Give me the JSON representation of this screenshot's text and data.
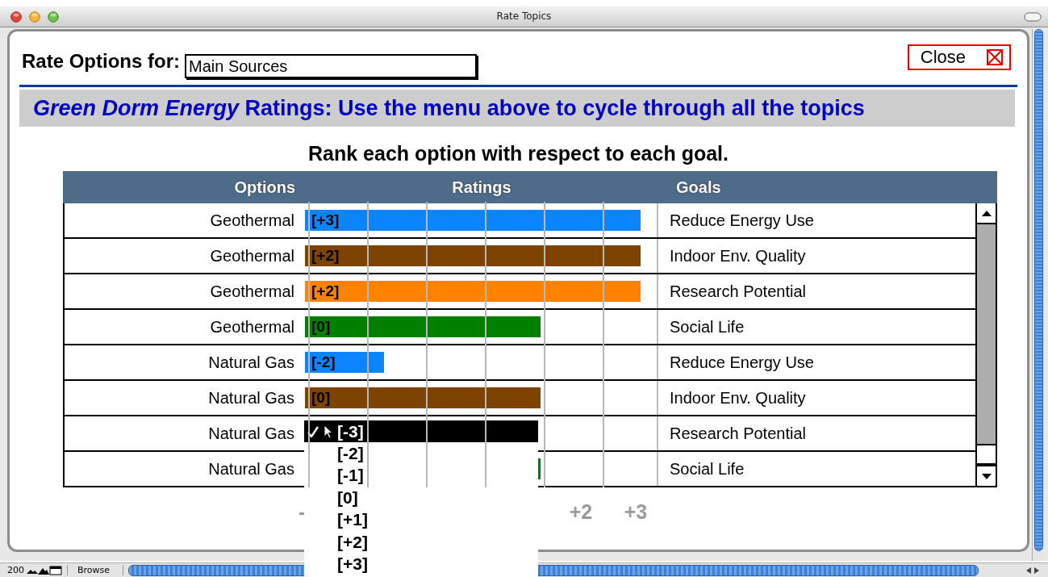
{
  "window": {
    "title": "Rate Topics"
  },
  "header": {
    "label": "Rate Options for:",
    "field_value": "Main Sources",
    "close_button": "Close"
  },
  "banner": "*Green Dorm Energy* Ratings: Use the menu above to cycle through all the topics",
  "instruction": "Rank each option with respect to each goal.",
  "table": {
    "columns": [
      "Options",
      "Ratings",
      "Goals"
    ],
    "rows": [
      {
        "option": "Geothermal",
        "rating": "[+3]",
        "level": 0.955,
        "color": "#0a84ff",
        "goal": "Reduce Energy Use"
      },
      {
        "option": "Geothermal",
        "rating": "[+2]",
        "level": 0.955,
        "color": "#7f4300",
        "goal": "Indoor Env. Quality"
      },
      {
        "option": "Geothermal",
        "rating": "[+2]",
        "level": 0.955,
        "color": "#ff8200",
        "goal": "Research Potential"
      },
      {
        "option": "Geothermal",
        "rating": "[0]",
        "level": 0.67,
        "color": "#007f00",
        "goal": "Social Life"
      },
      {
        "option": "Natural Gas",
        "rating": "[-2]",
        "level": 0.225,
        "color": "#0a84ff",
        "goal": "Reduce Energy Use"
      },
      {
        "option": "Natural Gas",
        "rating": "[0]",
        "level": 0.67,
        "color": "#7f4300",
        "goal": "Indoor Env. Quality"
      },
      {
        "option": "Natural Gas",
        "goal": "Research Potential"
      },
      {
        "option": "Natural Gas",
        "level": 0.67,
        "color": "#007f00",
        "goal": "Social Life"
      }
    ]
  },
  "scale_labels": [
    "-",
    "+2",
    "+3"
  ],
  "menu": {
    "items": [
      {
        "label": "[-3]",
        "selected": true
      },
      {
        "label": "[-2]",
        "selected": false
      },
      {
        "label": "[-1]",
        "selected": false
      },
      {
        "label": "[0]",
        "selected": false
      },
      {
        "label": "[+1]",
        "selected": false
      },
      {
        "label": "[+2]",
        "selected": false
      },
      {
        "label": "[+3]",
        "selected": false
      }
    ]
  },
  "status_bar": {
    "zoom": "200",
    "mode": "Browse"
  }
}
